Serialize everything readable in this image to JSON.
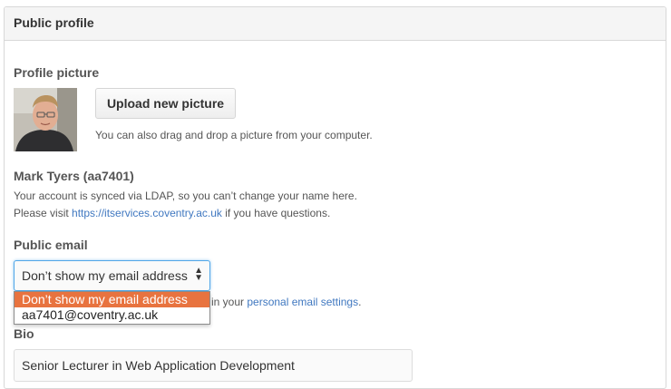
{
  "panel": {
    "title": "Public profile"
  },
  "profile_picture": {
    "label": "Profile picture",
    "upload_button": "Upload new picture",
    "hint": "You can also drag and drop a picture from your computer."
  },
  "name": {
    "heading": "Mark Tyers (aa7401)",
    "note_line1": "Your account is synced via LDAP, so you can’t change your name here.",
    "note_line2_prefix": "Please visit ",
    "note_link": "https://itservices.coventry.ac.uk",
    "note_line2_suffix": " if you have questions."
  },
  "public_email": {
    "label": "Public email",
    "selected": "Don’t show my email address",
    "options": [
      "Don’t show my email address",
      "aa7401@coventry.ac.uk"
    ],
    "hint_suffix_visible": "in your ",
    "hint_link": "personal email settings",
    "hint_end": "."
  },
  "bio": {
    "label": "Bio",
    "value": "Senior Lecturer in Web Application Development"
  },
  "colors": {
    "link": "#4078c0",
    "highlight": "#e8733f",
    "focus": "#51a7e8"
  }
}
